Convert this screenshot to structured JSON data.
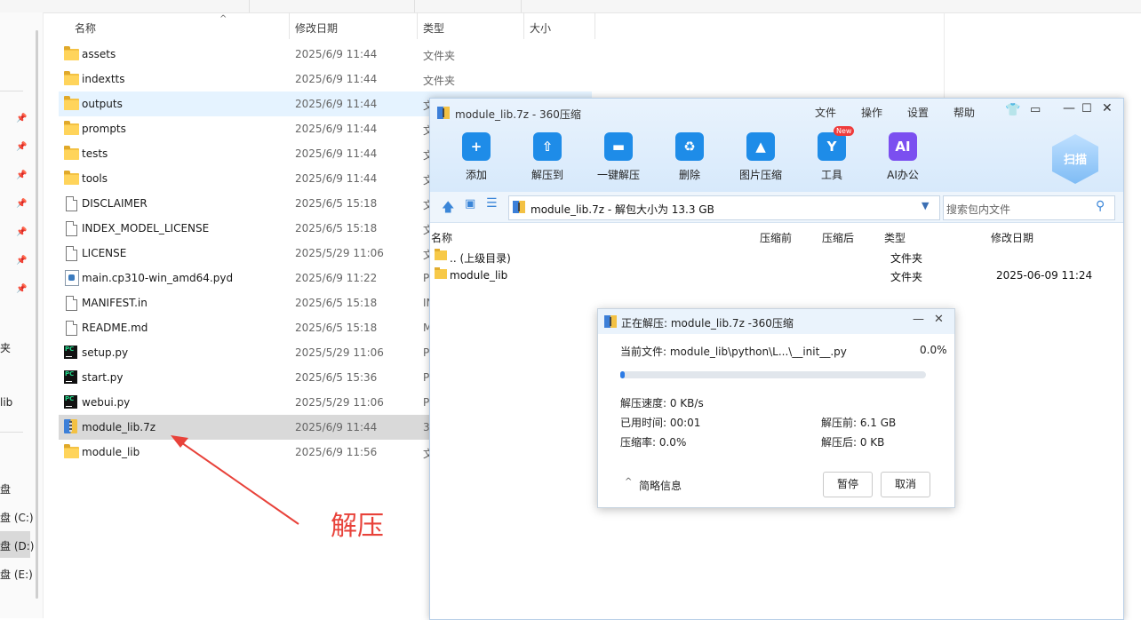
{
  "explorer": {
    "columns": {
      "name": "名称",
      "date": "修改日期",
      "type": "类型",
      "size": "大小"
    },
    "rows": [
      {
        "name": "assets",
        "date": "2025/6/9 11:44",
        "type": "文件夹",
        "icon": "folder-icon"
      },
      {
        "name": "indextts",
        "date": "2025/6/9 11:44",
        "type": "文件夹",
        "icon": "folder-icon"
      },
      {
        "name": "outputs",
        "date": "2025/6/9 11:44",
        "type": "文",
        "icon": "folder-icon"
      },
      {
        "name": "prompts",
        "date": "2025/6/9 11:44",
        "type": "文",
        "icon": "folder-icon"
      },
      {
        "name": "tests",
        "date": "2025/6/9 11:44",
        "type": "文",
        "icon": "folder-icon"
      },
      {
        "name": "tools",
        "date": "2025/6/9 11:44",
        "type": "文",
        "icon": "folder-icon"
      },
      {
        "name": "DISCLAIMER",
        "date": "2025/6/5 15:18",
        "type": "文",
        "icon": "document-icon"
      },
      {
        "name": "INDEX_MODEL_LICENSE",
        "date": "2025/6/5 15:18",
        "type": "文",
        "icon": "document-icon"
      },
      {
        "name": "LICENSE",
        "date": "2025/5/29 11:06",
        "type": "文",
        "icon": "document-icon"
      },
      {
        "name": "main.cp310-win_amd64.pyd",
        "date": "2025/6/9 11:22",
        "type": "P",
        "icon": "python-extension-icon"
      },
      {
        "name": "MANIFEST.in",
        "date": "2025/6/5 15:18",
        "type": "IN",
        "icon": "document-icon"
      },
      {
        "name": "README.md",
        "date": "2025/6/5 15:18",
        "type": "M",
        "icon": "document-icon"
      },
      {
        "name": "setup.py",
        "date": "2025/5/29 11:06",
        "type": "P",
        "icon": "pycharm-file-icon"
      },
      {
        "name": "start.py",
        "date": "2025/6/5 15:36",
        "type": "P",
        "icon": "pycharm-file-icon"
      },
      {
        "name": "webui.py",
        "date": "2025/5/29 11:06",
        "type": "P",
        "icon": "pycharm-file-icon"
      },
      {
        "name": "module_lib.7z",
        "date": "2025/6/9 11:44",
        "type": "3",
        "icon": "archive-7z-icon"
      },
      {
        "name": "module_lib",
        "date": "2025/6/9 11:56",
        "type": "文",
        "icon": "folder-icon"
      }
    ],
    "sidebar": {
      "labels": [
        "夹",
        "lib",
        "盘",
        "盘 (C:)",
        "盘 (D:)",
        "盘 (E:)"
      ]
    }
  },
  "app360": {
    "title": "module_lib.7z - 360压缩",
    "menu": [
      "文件",
      "操作",
      "设置",
      "帮助"
    ],
    "toolbar": [
      {
        "label": "添加",
        "icon": "add-icon",
        "color": "#1e8ce8"
      },
      {
        "label": "解压到",
        "icon": "extract-to-icon",
        "color": "#1e8ce8"
      },
      {
        "label": "一键解压",
        "icon": "one-click-extract-icon",
        "color": "#1e8ce8"
      },
      {
        "label": "删除",
        "icon": "delete-icon",
        "color": "#1e8ce8"
      },
      {
        "label": "图片压缩",
        "icon": "image-compress-icon",
        "color": "#1e8ce8"
      },
      {
        "label": "工具",
        "icon": "tools-icon",
        "color": "#1e8ce8"
      },
      {
        "label": "AI办公",
        "icon": "ai-office-icon",
        "color": "#7b4ff0"
      }
    ],
    "new_badge": "New",
    "scan_label": "扫描",
    "address": "module_lib.7z - 解包大小为 13.3 GB",
    "search_placeholder": "搜索包内文件",
    "list_columns": {
      "name": "名称",
      "before": "压缩前",
      "after": "压缩后",
      "type": "类型",
      "date": "修改日期"
    },
    "list_rows": [
      {
        "name": ".. (上级目录)",
        "type": "文件夹",
        "date": ""
      },
      {
        "name": "module_lib",
        "type": "文件夹",
        "date": "2025-06-09 11:24"
      }
    ]
  },
  "dialog": {
    "title": "正在解压: module_lib.7z -360压缩",
    "current_file": "当前文件: module_lib\\python\\L...\\__init__.py",
    "percent": "0.0%",
    "progress": 0.01,
    "speed": "解压速度: 0 KB/s",
    "elapsed": "已用时间: 00:01",
    "ratio": "压缩率:    0.0%",
    "before": "解压前: 6.1 GB",
    "after": "解压后: 0 KB",
    "brief": "简略信息",
    "pause": "暂停",
    "cancel": "取消"
  },
  "annotation": "解压",
  "colors": {
    "accent": "#2c7be5",
    "arrow": "#e8423a",
    "selected_row": "#d9d9d9",
    "hover_row": "#e5f3ff"
  }
}
